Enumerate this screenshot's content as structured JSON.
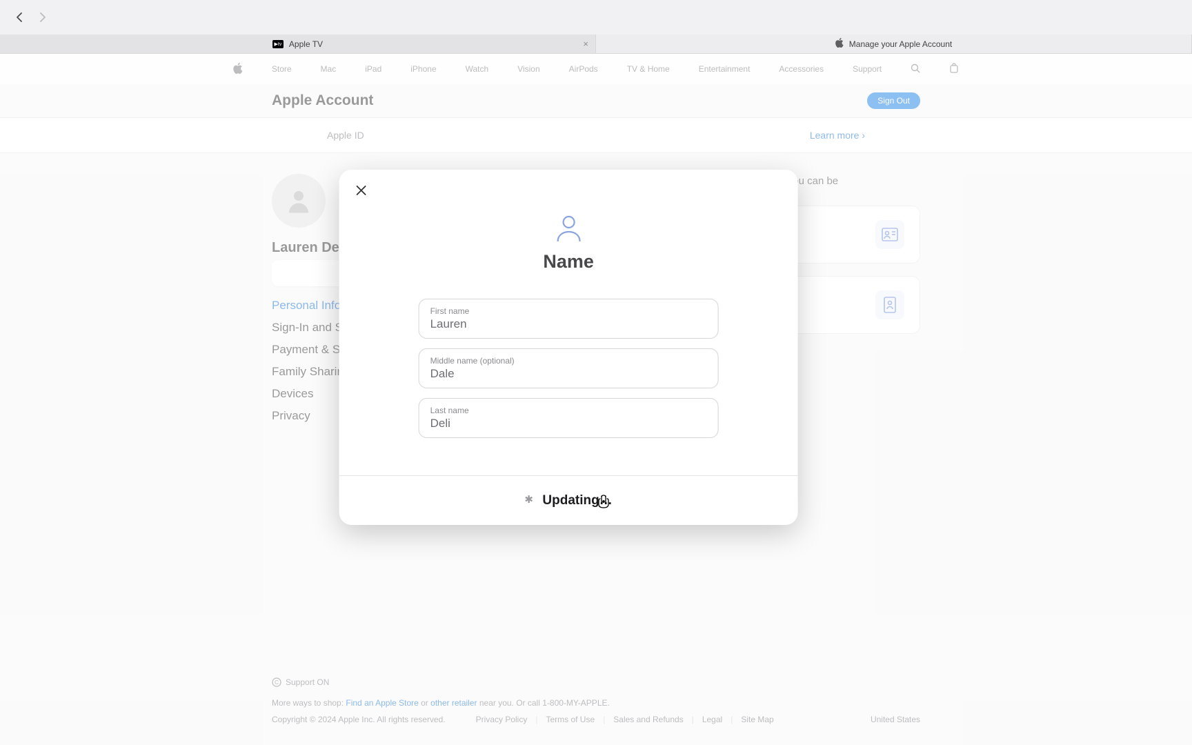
{
  "browser": {
    "tabs": [
      {
        "label": "Apple TV",
        "icon": "tv"
      },
      {
        "label": "Manage your Apple Account",
        "icon": "apple"
      }
    ]
  },
  "global_nav": {
    "items": [
      "Store",
      "Mac",
      "iPad",
      "iPhone",
      "Watch",
      "Vision",
      "AirPods",
      "TV & Home",
      "Entertainment",
      "Accessories",
      "Support"
    ]
  },
  "account_header": {
    "title": "Apple Account",
    "signout": "Sign Out"
  },
  "notice": {
    "prefix": "Apple ID",
    "learn_more": "Learn more"
  },
  "sidebar": {
    "display_name": "Lauren Deli",
    "items": [
      "Personal Information",
      "Sign-In and Security",
      "Payment & Shipping",
      "Family Sharing",
      "Devices",
      "Privacy"
    ]
  },
  "content": {
    "desc_suffix": "where you can be"
  },
  "modal": {
    "title": "Name",
    "fields": {
      "first": {
        "label": "First name",
        "value": "Lauren"
      },
      "middle": {
        "label": "Middle name (optional)",
        "value": "Dale"
      },
      "last": {
        "label": "Last name",
        "value": "Deli"
      }
    },
    "footer_status": "Updating…"
  },
  "footer": {
    "support": "Support ON",
    "shop_prefix": "More ways to shop: ",
    "shop_link1": "Find an Apple Store",
    "shop_mid": " or ",
    "shop_link2": "other retailer",
    "shop_suffix": " near you. Or call 1-800-MY-APPLE.",
    "copyright": "Copyright © 2024 Apple Inc. All rights reserved.",
    "links": [
      "Privacy Policy",
      "Terms of Use",
      "Sales and Refunds",
      "Legal",
      "Site Map"
    ],
    "country": "United States"
  }
}
